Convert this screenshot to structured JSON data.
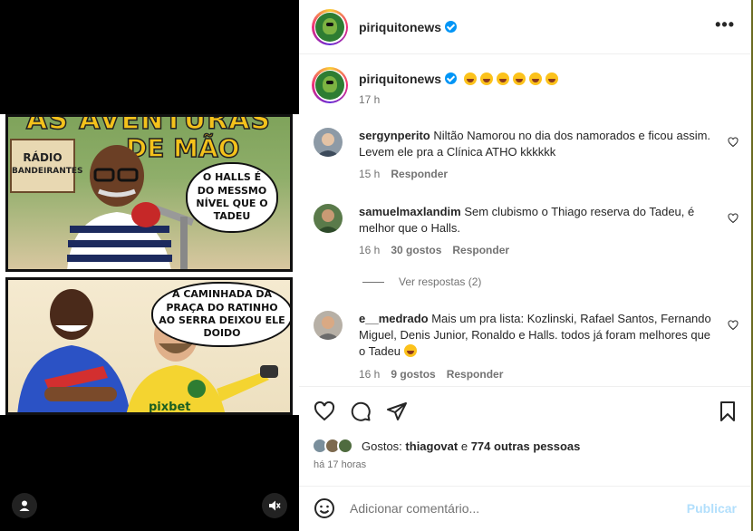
{
  "post": {
    "author": "piriquitonews",
    "more_label": "•••",
    "caption_time": "17 h"
  },
  "comic": {
    "title": "AS AVENTURAS",
    "subtitle": "DE MÃO",
    "sign_line1": "RÁDIO",
    "sign_line2": "BANDEIRANTES",
    "bubble_top": "O HALLS É DO MESSMO NÍVEL QUE O TADEU",
    "bubble_bottom": "A CAMINHADA DA PRAÇA DO RATINHO AO SERRA DEIXOU ELE DOIDO",
    "shirt_text": "pixbet"
  },
  "comments": [
    {
      "user": "sergynperito",
      "text": "Niltão Namorou no dia dos namorados e ficou assim. Levem ele pra a Clínica ATHO kkkkkk",
      "time": "15 h",
      "likes": "",
      "reply": "Responder"
    },
    {
      "user": "samuelmaxlandim",
      "text": "Sem clubismo o Thiago reserva do Tadeu, é melhor que o Halls.",
      "time": "16 h",
      "likes": "30 gostos",
      "reply": "Responder",
      "view_replies": "Ver respostas (2)"
    },
    {
      "user": "e__medrado",
      "text": "Mais um pra lista: Kozlinski, Rafael Santos, Fernando Miguel, Denis Junior, Ronaldo e Halls. todos já foram melhores que o Tadeu",
      "time": "16 h",
      "likes": "9 gostos",
      "reply": "Responder"
    }
  ],
  "likes": {
    "prefix": "Gostos:",
    "user": "thiagovat",
    "connector": "e",
    "others": "774 outras pessoas"
  },
  "post_time": "há 17 horas",
  "compose": {
    "placeholder": "Adicionar comentário...",
    "publish_label": "Publicar"
  },
  "icons": {
    "like": "heart-icon",
    "comment": "comment-icon",
    "share": "send-icon",
    "save": "bookmark-icon",
    "emoji": "emoji-icon",
    "user": "user-icon",
    "mute": "muted-speaker-icon"
  },
  "colors": {
    "verified": "#0095f6",
    "publish_disabled": "#b2dffc",
    "comic_yellow": "#f4c21b"
  }
}
